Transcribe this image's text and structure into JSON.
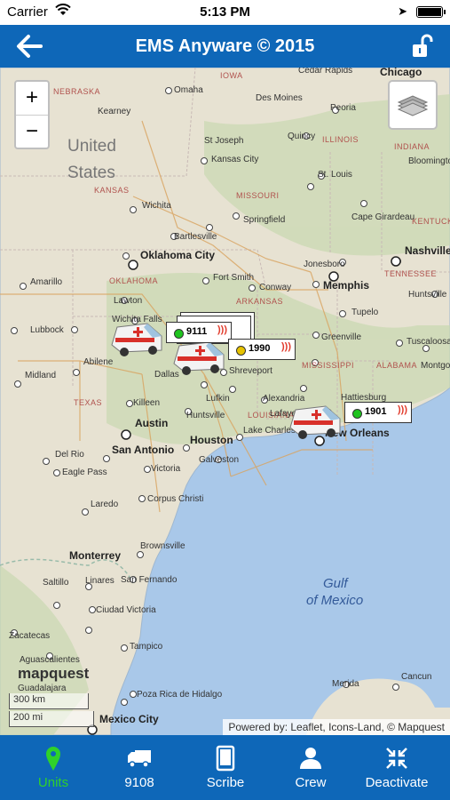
{
  "status": {
    "carrier": "Carrier",
    "time": "5:13 PM"
  },
  "nav": {
    "title": "EMS Anyware © 2015"
  },
  "map": {
    "zoom_in": "+",
    "zoom_out": "−",
    "logo": "mapquest",
    "scale_km": "300 km",
    "scale_mi": "200 mi",
    "attribution": "Powered by: Leaflet, Icons-Land, © Mapquest",
    "country": [
      "United",
      "States"
    ],
    "water": [
      "Gulf",
      "of Mexico"
    ],
    "states": [
      "NEBRASKA",
      "IOWA",
      "ILLINOIS",
      "INDIANA",
      "KANSAS",
      "MISSOURI",
      "OKLAHOMA",
      "ARKANSAS",
      "TENNESSEE",
      "MISSISSIPPI",
      "ALABAMA",
      "TEXAS",
      "LOUISIANA",
      "KENTUCKY"
    ],
    "cities": [
      "Omaha",
      "Cedar Rapids",
      "Chicago",
      "Kearney",
      "Des Moines",
      "Peoria",
      "St Joseph",
      "Quincy",
      "Bloomington",
      "Kansas City",
      "St. Louis",
      "Wichita",
      "Springfield",
      "Cape Girardeau",
      "Bartlesville",
      "Oklahoma City",
      "Nashville",
      "Amarillo",
      "Jonesboro",
      "Fort Smith",
      "Memphis",
      "Huntsville",
      "Lawton",
      "Conway",
      "Tupelo",
      "Lubbock",
      "Wichita Falls",
      "Abilene",
      "Dallas",
      "Greenville",
      "Tuscaloosa",
      "Midland",
      "Shreveport",
      "Montgomery",
      "Lufkin",
      "Alexandria",
      "Hattiesburg",
      "Killeen",
      "Austin",
      "Huntsville",
      "Lafayette",
      "Houston",
      "Lake Charles",
      "New Orleans",
      "Del Rio",
      "San Antonio",
      "Galveston",
      "Eagle Pass",
      "Victoria",
      "Laredo",
      "Corpus Christi",
      "Brownsville",
      "Monterrey",
      "San Fernando",
      "Linares",
      "Ciudad Victoria",
      "Saltillo",
      "Zacatecas",
      "Tampico",
      "Aguascalientes",
      "Guadalajara",
      "Poza Rica de Hidalgo",
      "Mexico City",
      "Merida",
      "Cancun",
      "Amarillo",
      "Abilene"
    ],
    "city_labels_big": [
      "Oklahoma City",
      "Memphis",
      "Austin",
      "San Antonio",
      "Houston",
      "Monterrey",
      "Mexico City",
      "Nashville"
    ],
    "units": [
      {
        "id": "9111",
        "status": "green"
      },
      {
        "id": "1990",
        "status": "yellow"
      },
      {
        "id": "1901",
        "status": "green"
      }
    ]
  },
  "tabs": [
    {
      "label": "Units",
      "icon": "map-pin-icon",
      "active": true
    },
    {
      "label": "9108",
      "icon": "truck-icon",
      "active": false
    },
    {
      "label": "Scribe",
      "icon": "tablet-icon",
      "active": false
    },
    {
      "label": "Crew",
      "icon": "person-icon",
      "active": false
    },
    {
      "label": "Deactivate",
      "icon": "collapse-arrows-icon",
      "active": false
    }
  ],
  "colors": {
    "brand": "#0e67b8",
    "active_tab": "#2fd12a",
    "unit_green": "#1fc41f",
    "unit_yellow": "#e6c200",
    "signal": "#e23b2c"
  }
}
